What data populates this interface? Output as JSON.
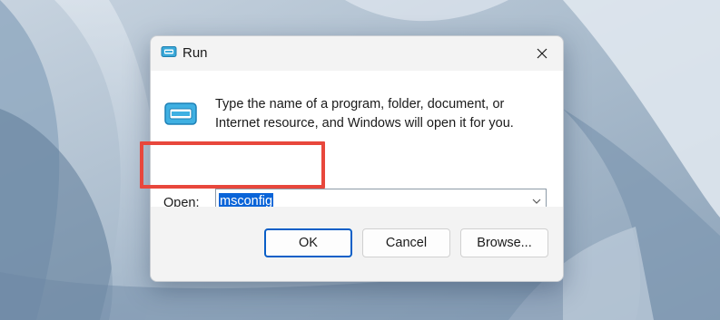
{
  "dialog": {
    "title": "Run",
    "icon": "run-icon",
    "description_line1": "Type the name of a program, folder, document, or",
    "description_line2": "Internet resource, and Windows will open it for you.",
    "open_label": "Open:",
    "open_value": "msconfig",
    "buttons": {
      "ok": "OK",
      "cancel": "Cancel",
      "browse": "Browse..."
    }
  },
  "colors": {
    "highlight_annotation": "#e8473c",
    "selection": "#0a64d8",
    "primary_border": "#0a5fc7"
  }
}
